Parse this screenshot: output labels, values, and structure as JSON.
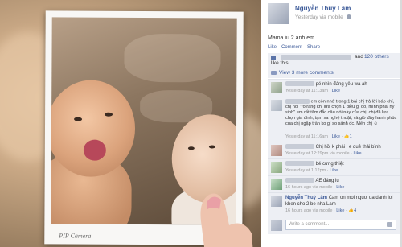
{
  "photo": {
    "watermark": "PIP Camera"
  },
  "post": {
    "author": "Nguyễn Thuỳ Lâm",
    "meta": "Yesterday via mobile",
    "text": "Mama iu 2 anh em...",
    "actions": [
      "Like",
      "Comment",
      "Share"
    ]
  },
  "likes": {
    "and": "and",
    "others": "120 others",
    "suffix": "like this."
  },
  "view_comments": "View 3 more comments",
  "comments": [
    {
      "text": "pé nhìn đáng yêu wa ah",
      "time": "Yesterday at 11:13am",
      "actions": [
        "Like"
      ]
    },
    {
      "text": "em còn nhớ trong 1 bài chị trả lời báo chí, chị nói \"rõ ràng khi lựa chọn 1 điều gì đó, mình phải hy sinh\" em rất tâm đắc câu nói này của chị. chị đã lựa chọn gia đình, tạm xa nghệ thuật, và giờ đây hạnh phúc của chị ngập tràn ko gì so sánh đc. Mến chị",
      "emoji": "☺",
      "time": "Yesterday at 11:16am",
      "actions": [
        "Like"
      ],
      "like_count": "1"
    },
    {
      "text": "Chị hồi k phải , e quê thái bình",
      "time": "Yesterday at 12:29pm via mobile",
      "actions": [
        "Like"
      ]
    },
    {
      "text": "bé cưng thiệt",
      "time": "Yesterday at 1:12pm",
      "actions": [
        "Like"
      ]
    },
    {
      "text": "AE đáng iu",
      "time": "16 hours ago via mobile",
      "actions": [
        "Like"
      ]
    },
    {
      "author": "Nguyễn Thuỳ Lâm",
      "text": "Cam on moi nguoi da danh loi khen cho 2 be nha Lam",
      "time": "16 hours ago via mobile",
      "actions": [
        "Like"
      ],
      "like_count": "4"
    }
  ],
  "write_comment": {
    "placeholder": "Write a comment..."
  },
  "colors": {
    "link": "#3b5998",
    "panel_bg": "#edeff4"
  }
}
